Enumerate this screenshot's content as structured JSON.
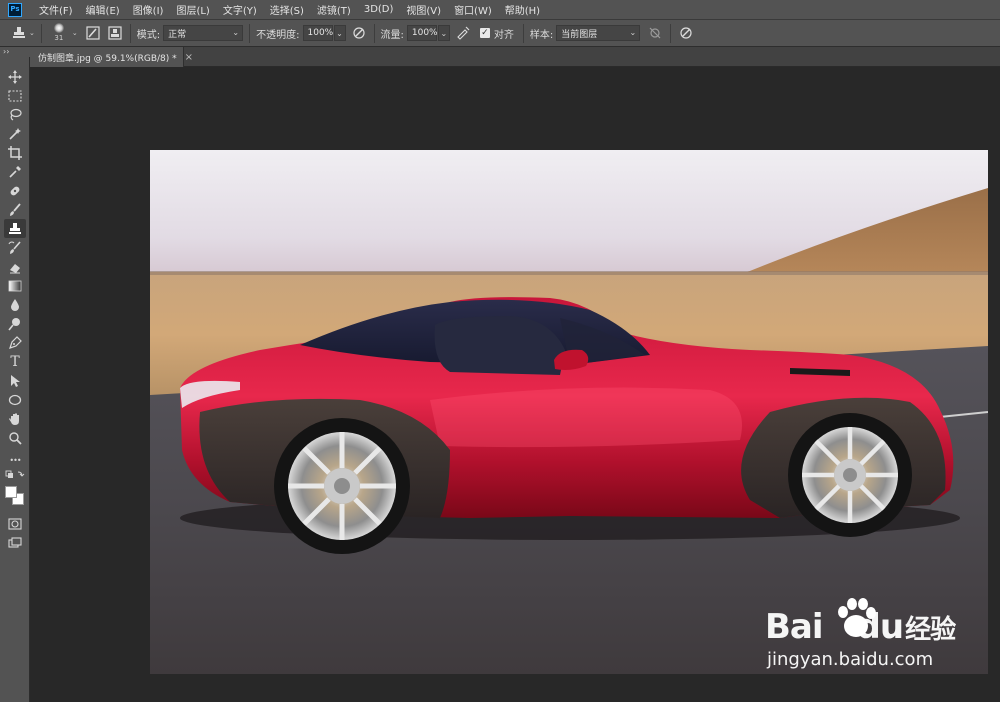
{
  "app": {
    "logo_text": "Ps"
  },
  "menu": [
    "文件(F)",
    "编辑(E)",
    "图像(I)",
    "图层(L)",
    "文字(Y)",
    "选择(S)",
    "滤镜(T)",
    "3D(D)",
    "视图(V)",
    "窗口(W)",
    "帮助(H)"
  ],
  "options": {
    "brush_size": "31",
    "mode_label": "模式:",
    "mode_value": "正常",
    "opacity_label": "不透明度:",
    "opacity_value": "100%",
    "flow_label": "流量:",
    "flow_value": "100%",
    "aligned_label": "对齐",
    "aligned_checked": true,
    "sample_label": "样本:",
    "sample_value": "当前图层"
  },
  "collapse_glyph": "››",
  "document_tab": {
    "title": "仿制图章.jpg @ 59.1%(RGB/8) *",
    "close_glyph": "×"
  },
  "tools": [
    "move-tool",
    "marquee-tool",
    "lasso-tool",
    "magic-wand-tool",
    "crop-tool",
    "eyedropper-tool",
    "healing-brush-tool",
    "brush-tool",
    "clone-stamp-tool",
    "history-brush-tool",
    "eraser-tool",
    "gradient-tool",
    "blur-tool",
    "dodge-tool",
    "pen-tool",
    "type-tool",
    "path-selection-tool",
    "ellipse-tool",
    "hand-tool",
    "zoom-tool",
    "more-tools"
  ],
  "type_tool_glyph": "T",
  "more_tools_glyph": "•••",
  "colors": {
    "foreground": "#ffffff",
    "background": "#ffffff"
  },
  "watermark": {
    "brand_bai": "Bai",
    "brand_du": "du",
    "brand_jy": "经验",
    "url": "jingyan.baidu.com"
  }
}
